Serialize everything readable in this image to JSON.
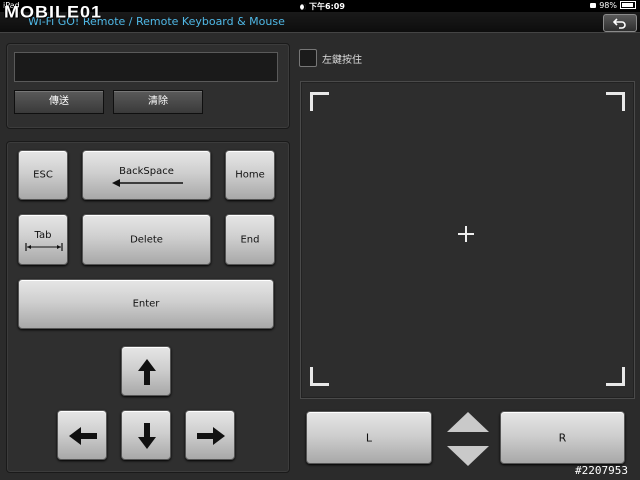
{
  "status_bar": {
    "device": "iPad",
    "time": "下午6:09",
    "battery": "98%"
  },
  "header": {
    "logo": "MOBILE01",
    "title": "Wi-Fi GO! Remote / Remote Keyboard & Mouse",
    "back_icon": "undo-arrow-icon"
  },
  "text_panel": {
    "input_value": "",
    "send_label": "傳送",
    "clear_label": "清除"
  },
  "keys": {
    "esc": "ESC",
    "backspace": "BackSpace",
    "home": "Home",
    "tab": "Tab",
    "delete": "Delete",
    "end": "End",
    "enter": "Enter"
  },
  "mouse": {
    "hold_left_label": "左鍵按住",
    "hold_left_checked": false,
    "left": "L",
    "right": "R"
  },
  "watermark": "#2207953"
}
